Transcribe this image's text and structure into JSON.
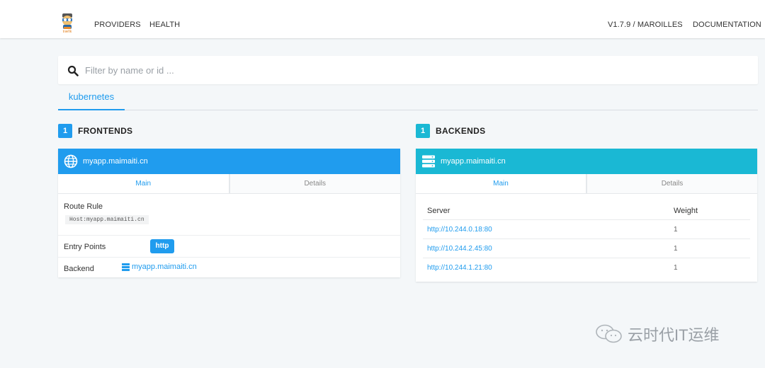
{
  "nav": {
    "links": [
      "PROVIDERS",
      "HEALTH"
    ],
    "version": "V1.7.9 / MAROILLES",
    "documentation": "DOCUMENTATION",
    "logo_text": "træfik"
  },
  "search": {
    "placeholder": "Filter by name or id ...",
    "value": ""
  },
  "provider_tab": "kubernetes",
  "frontends": {
    "count": "1",
    "title": "FRONTENDS",
    "card": {
      "name": "myapp.maimaiti.cn",
      "tabs": [
        "Main",
        "Details"
      ],
      "route_rule_label": "Route Rule",
      "route_rule_value": "Host:myapp.maimaiti.cn",
      "entry_points_label": "Entry Points",
      "entry_point": "http",
      "backend_label": "Backend",
      "backend_value": "myapp.maimaiti.cn"
    }
  },
  "backends": {
    "count": "1",
    "title": "BACKENDS",
    "card": {
      "name": "myapp.maimaiti.cn",
      "tabs": [
        "Main",
        "Details"
      ],
      "columns": [
        "Server",
        "Weight"
      ],
      "servers": [
        {
          "url": "http://10.244.0.18:80",
          "weight": "1"
        },
        {
          "url": "http://10.244.2.45:80",
          "weight": "1"
        },
        {
          "url": "http://10.244.1.21:80",
          "weight": "1"
        }
      ]
    }
  },
  "watermark": "云时代IT运维",
  "colors": {
    "accent": "#209cee",
    "frontend_header": "#209cee",
    "backend_header": "#1ab8d4",
    "background": "#f4f7f9"
  },
  "icons": {
    "search": "search-icon",
    "globe": "globe-icon",
    "server": "server-icon",
    "wechat": "wechat-icon"
  }
}
